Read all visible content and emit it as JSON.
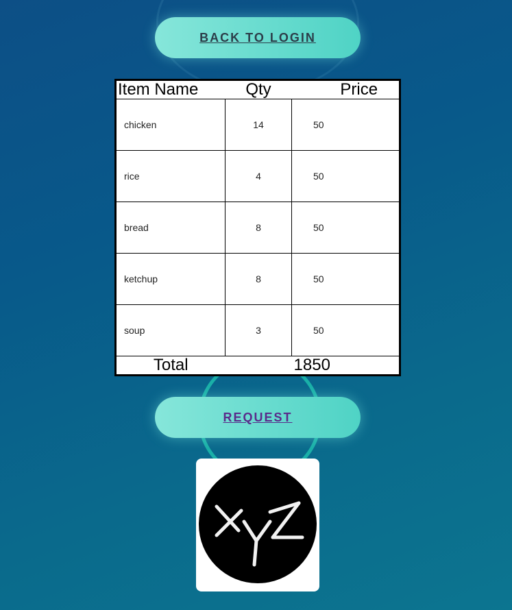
{
  "header": {
    "back_button_label": "BACK TO LOGIN"
  },
  "table": {
    "columns": [
      "Item Name",
      "Qty",
      "Price"
    ],
    "rows": [
      {
        "name": "chicken",
        "qty": "14",
        "price": "50"
      },
      {
        "name": "rice",
        "qty": "4",
        "price": "50"
      },
      {
        "name": "bread",
        "qty": "8",
        "price": "50"
      },
      {
        "name": "ketchup",
        "qty": "8",
        "price": "50"
      },
      {
        "name": "soup",
        "qty": "3",
        "price": "50"
      }
    ],
    "total_label": "Total",
    "total_value": "1850"
  },
  "actions": {
    "request_label": "REQUEST"
  },
  "logo": {
    "text": "XYZ",
    "icon": "xyz-logo-icon"
  },
  "colors": {
    "button_gradient_start": "#86e6da",
    "button_gradient_end": "#4fd3c5",
    "background": "#08598a",
    "back_button_text": "#2c3e4a",
    "request_button_text": "#5a2a8a",
    "ring": "#1ab0a8"
  }
}
